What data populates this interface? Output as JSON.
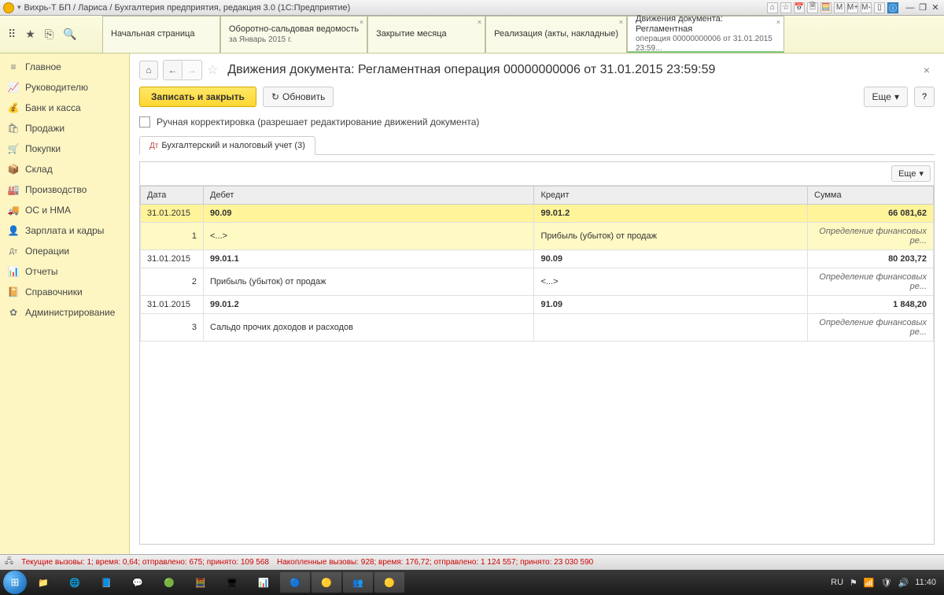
{
  "titlebar": {
    "title": "Вихрь-Т БП / Лариса / Бухгалтерия предприятия, редакция 3.0   (1С:Предприятие)",
    "m_labels": [
      "M",
      "M+",
      "M-"
    ]
  },
  "tabs": [
    {
      "l1": "Начальная страница",
      "l2": ""
    },
    {
      "l1": "Оборотно-сальдовая ведомость",
      "l2": "за Январь 2015 г."
    },
    {
      "l1": "Закрытие месяца",
      "l2": ""
    },
    {
      "l1": "Реализация (акты, накладные)",
      "l2": ""
    },
    {
      "l1": "Движения документа: Регламентная",
      "l2": "операция 00000000006 от 31.01.2015 23:59..."
    }
  ],
  "sidebar": [
    {
      "icon": "≡",
      "label": "Главное"
    },
    {
      "icon": "📈",
      "label": "Руководителю"
    },
    {
      "icon": "🏦",
      "label": "Банк и касса"
    },
    {
      "icon": "🛍",
      "label": "Продажи"
    },
    {
      "icon": "🛒",
      "label": "Покупки"
    },
    {
      "icon": "📦",
      "label": "Склад"
    },
    {
      "icon": "🏭",
      "label": "Производство"
    },
    {
      "icon": "🚚",
      "label": "ОС и НМА"
    },
    {
      "icon": "👤",
      "label": "Зарплата и кадры"
    },
    {
      "icon": "Дт",
      "label": "Операции"
    },
    {
      "icon": "📊",
      "label": "Отчеты"
    },
    {
      "icon": "📔",
      "label": "Справочники"
    },
    {
      "icon": "⚙",
      "label": "Администрирование"
    }
  ],
  "doc": {
    "title": "Движения документа: Регламентная операция 00000000006 от 31.01.2015 23:59:59",
    "save_close": "Записать и закрыть",
    "refresh": "Обновить",
    "more": "Еще",
    "help": "?",
    "manual_edit": "Ручная корректировка (разрешает редактирование движений документа)",
    "subtab": "Бухгалтерский и налоговый учет (3)"
  },
  "table": {
    "more": "Еще",
    "headers": {
      "date": "Дата",
      "debit": "Дебет",
      "credit": "Кредит",
      "sum": "Сумма"
    },
    "rows": [
      {
        "date": "31.01.2015",
        "n": "1",
        "debit": "90.09",
        "debit2": "<...>",
        "credit": "99.01.2",
        "credit2": "Прибыль (убыток) от продаж",
        "sum": "66 081,62",
        "desc": "Определение финансовых ре...",
        "hl": true
      },
      {
        "date": "31.01.2015",
        "n": "2",
        "debit": "99.01.1",
        "debit2": "Прибыль (убыток) от продаж",
        "credit": "90.09",
        "credit2": "<...>",
        "sum": "80 203,72",
        "desc": "Определение финансовых ре..."
      },
      {
        "date": "31.01.2015",
        "n": "3",
        "debit": "99.01.2",
        "debit2": "Сальдо прочих доходов и расходов",
        "credit": "91.09",
        "credit2": "",
        "sum": "1 848,20",
        "desc": "Определение финансовых ре..."
      }
    ]
  },
  "status": {
    "text1": "Текущие вызовы: 1; время: 0,64; отправлено: 675; принято: 109 568",
    "text2": "Накопленные вызовы: 928; время: 176,72; отправлено: 1 124 557; принято: 23 030 590"
  },
  "tray": {
    "lang": "RU",
    "time": "11:40"
  }
}
